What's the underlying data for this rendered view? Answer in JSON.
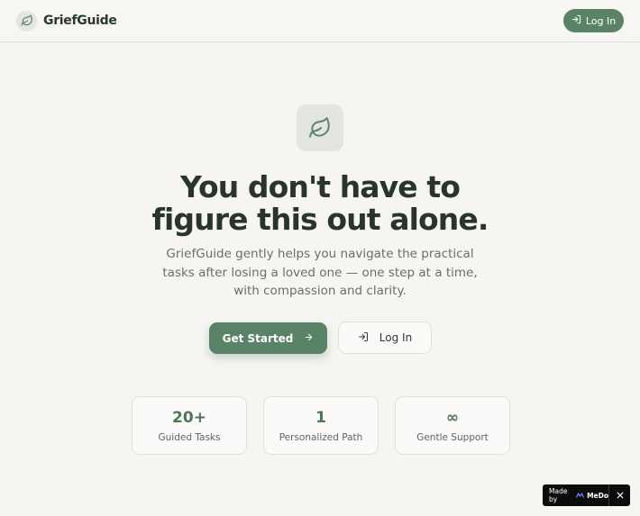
{
  "header": {
    "brand_name": "GriefGuide",
    "login_label": "Log In"
  },
  "hero": {
    "headline_line1": "You don't have to",
    "headline_line2": "figure this out alone.",
    "subtitle": "GriefGuide gently helps you navigate the practical tasks after losing a loved one — one step at a time, with compassion and clarity.",
    "primary_button": "Get Started",
    "secondary_button": "Log In"
  },
  "stats": [
    {
      "value": "20+",
      "label": "Guided Tasks"
    },
    {
      "value": "1",
      "label": "Personalized Path"
    },
    {
      "value": "∞",
      "label": "Gentle Support"
    }
  ],
  "badge": {
    "made_by": "Made by",
    "brand": "MeDo"
  },
  "icons": {
    "brand": "leaf-icon",
    "hero": "leaf-icon",
    "login": "log-in-icon",
    "arrow": "arrow-right-icon",
    "close": "close-icon"
  },
  "colors": {
    "accent": "#5a8266",
    "background": "#f6f5f2",
    "heading": "#28342c"
  }
}
